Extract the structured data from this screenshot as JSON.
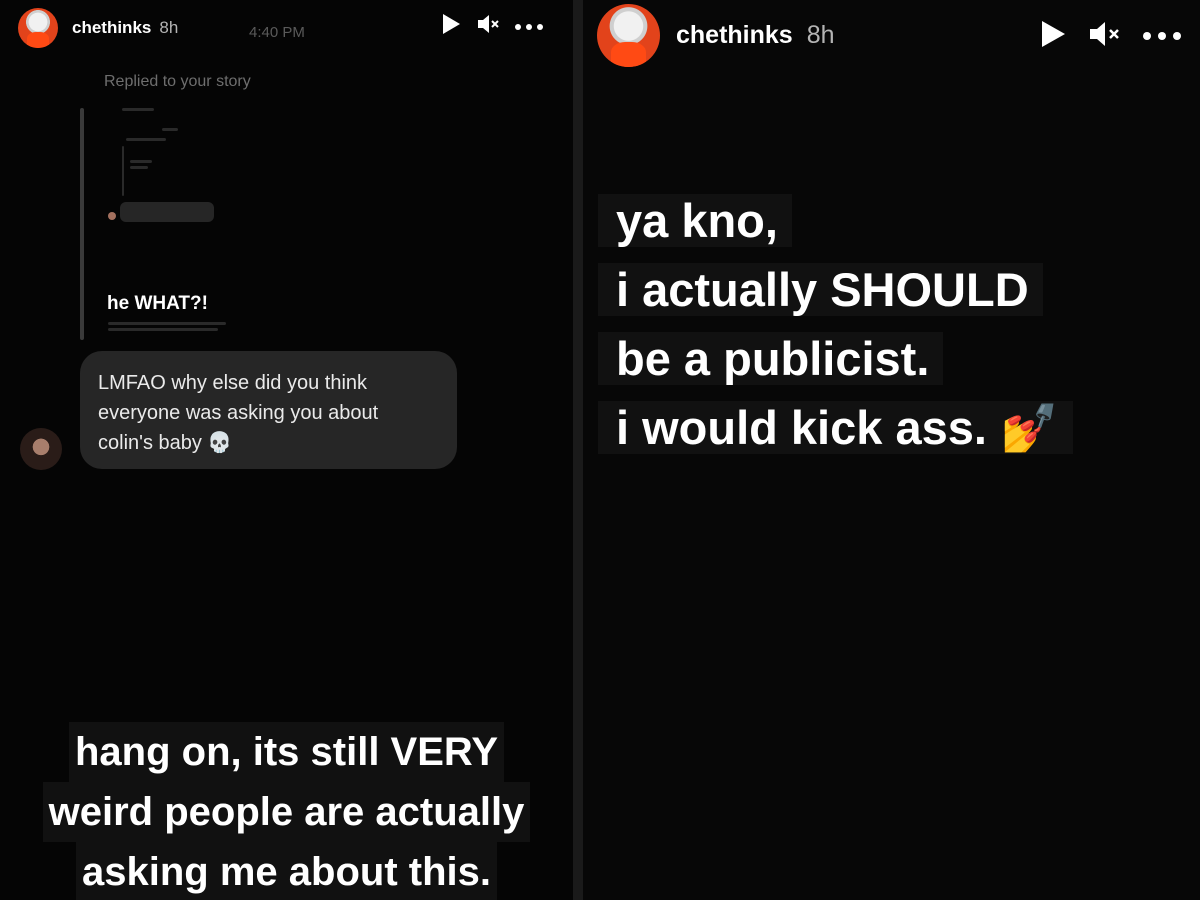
{
  "left_story": {
    "username": "chethinks",
    "time_ago": "8h",
    "clock": "4:40 PM",
    "replied_label": "Replied to your story",
    "quoted_story_caption": "he WHAT?!",
    "message": {
      "line1": "LMFAO why else did you think",
      "line2": "everyone was asking you about",
      "line3": "colin's baby 💀"
    },
    "caption": {
      "line1": "hang on, its still VERY",
      "line2": "weird people are actually",
      "line3": "asking me about this."
    }
  },
  "right_story": {
    "username": "chethinks",
    "time_ago": "8h",
    "caption": {
      "line1": "ya kno,",
      "line2": "i actually SHOULD",
      "line3": "be a publicist.",
      "line4": "i would kick ass. 💅"
    }
  },
  "icons": {
    "play": "play-icon",
    "mute": "mute-icon",
    "more": "more-icon"
  },
  "colors": {
    "background": "#050505",
    "bubble": "#262626",
    "text": "#ffffff",
    "muted_text": "#6e6e6e"
  }
}
